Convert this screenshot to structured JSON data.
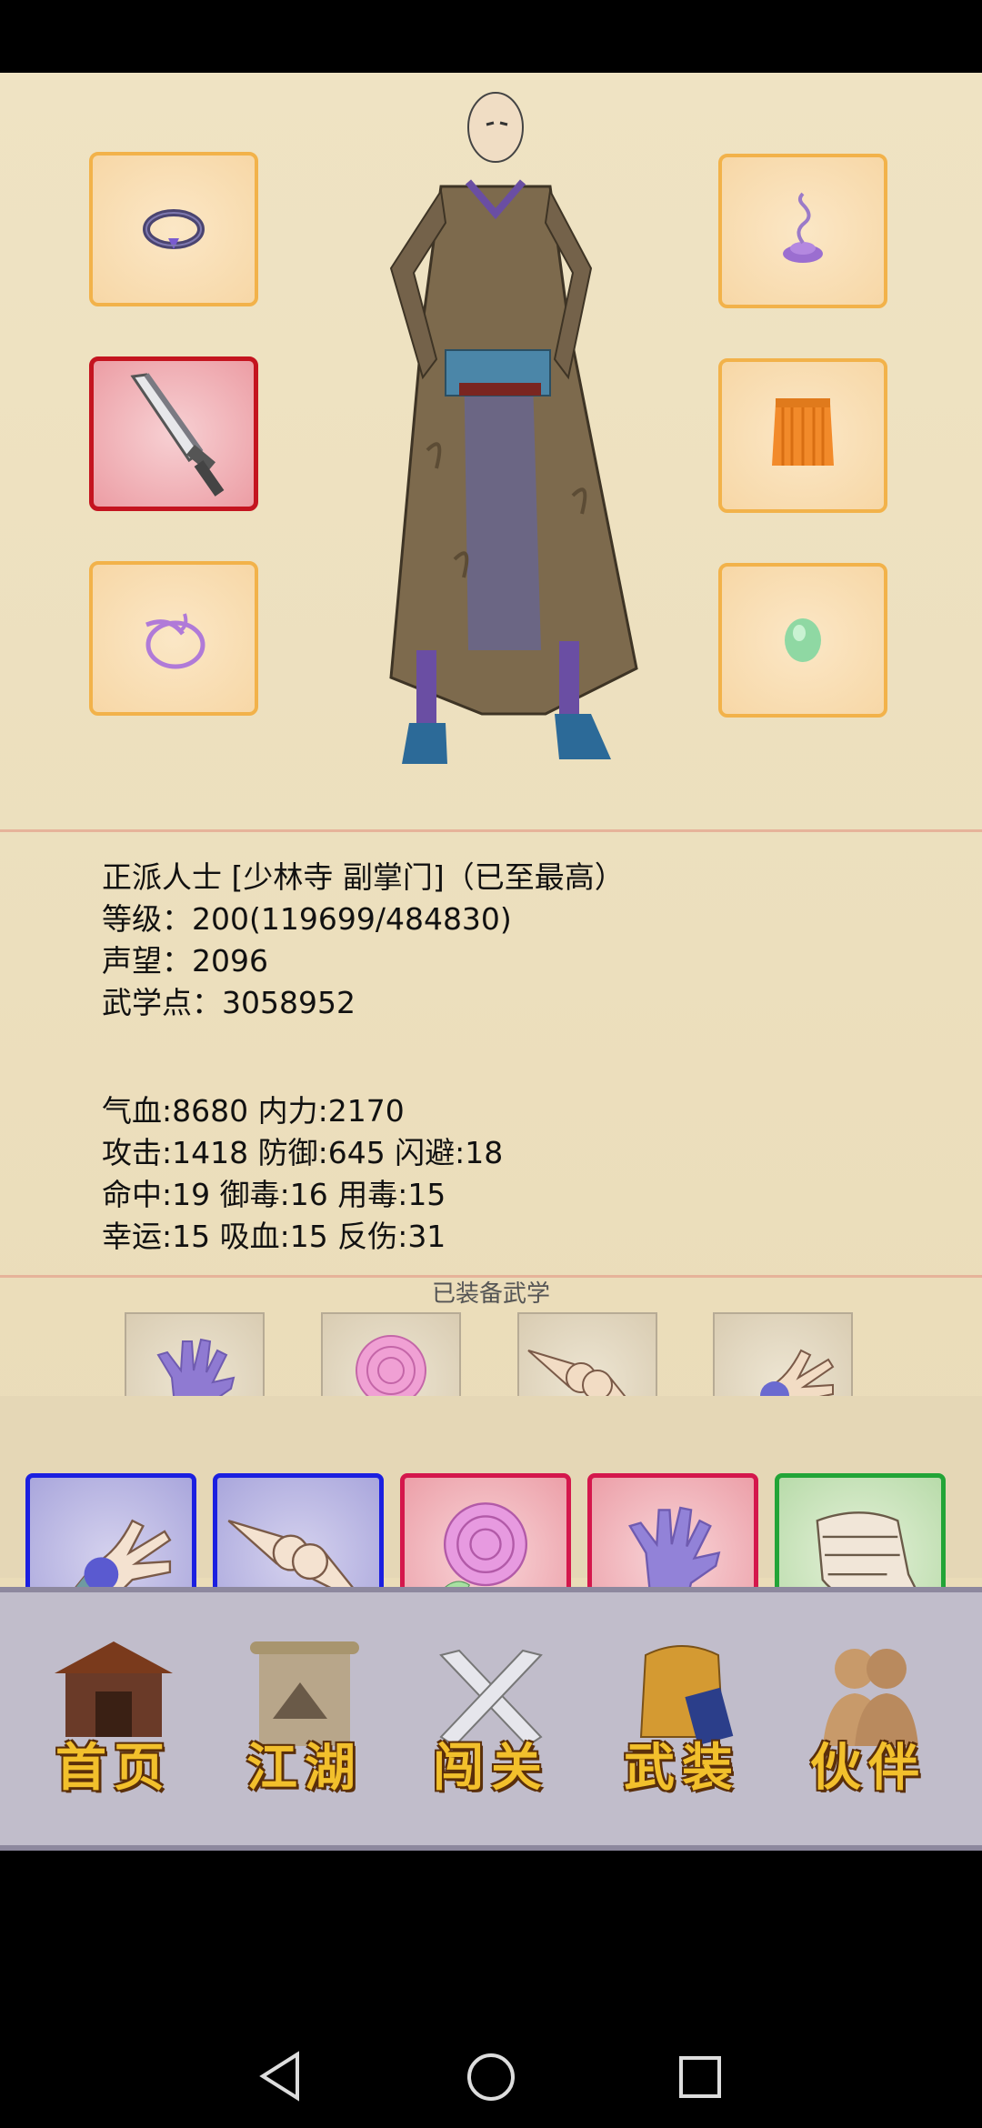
{
  "character": {
    "faction_line": "正派人士 [少林寺 副掌门]（已至最高）",
    "level_line": "等级：200(119699/484830)",
    "reputation_line": "声望：2096",
    "martial_points_line": "武学点：3058952"
  },
  "stats": {
    "line1": "气血:8680  内力:2170",
    "line2": "攻击:1418  防御:645  闪避:18",
    "line3": "命中:19  御毒:16  用毒:15",
    "line4": "幸运:15  吸血:15  反伤:31"
  },
  "equipped_skills_title": "已装备武学",
  "equipment_slots": {
    "left": [
      "bracelet-icon",
      "sword-icon",
      "ring-icon"
    ],
    "right": [
      "incense-icon",
      "armor-icon",
      "jade-icon"
    ]
  },
  "skills_small": [
    "palm-icon",
    "rose-icon",
    "fist-bump-icon",
    "claw-icon"
  ],
  "skills_big": [
    "claw-icon",
    "fist-bump-icon",
    "rose-icon",
    "palm-icon",
    "fist-icon"
  ],
  "nav": {
    "home": "首页",
    "jianghu": "江湖",
    "challenge": "闯关",
    "gear": "武装",
    "partner": "伙伴"
  },
  "colors": {
    "slot_border": "#f2b24a",
    "slot_selected": "#c4141f",
    "skill_blue": "#1b1fe0",
    "skill_red": "#d4174c",
    "skill_green": "#22a437",
    "nav_text": "#f2c02c"
  }
}
